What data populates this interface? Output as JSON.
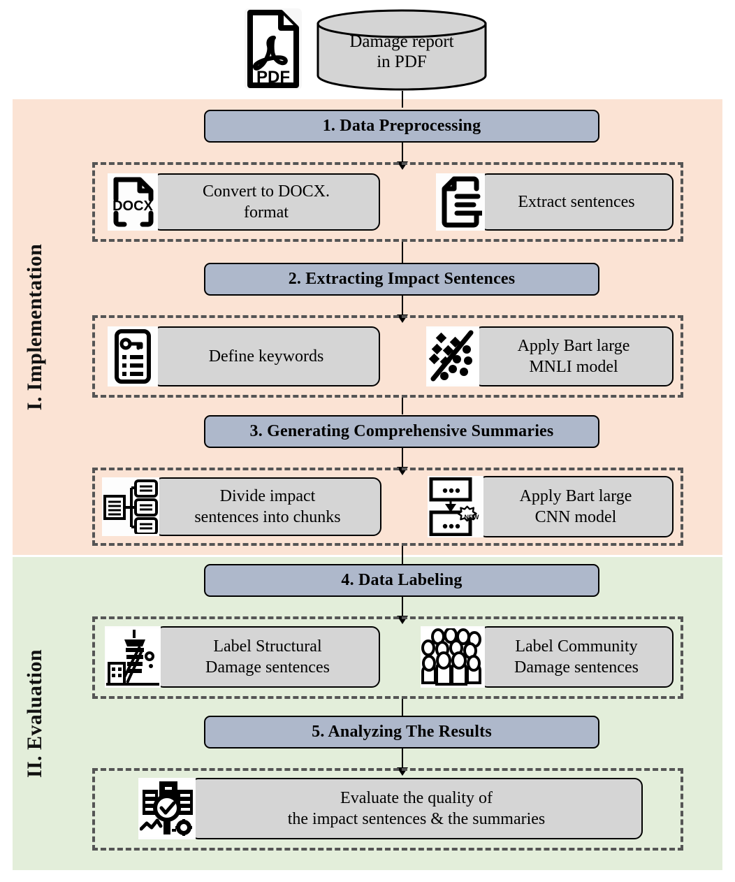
{
  "source": {
    "pdf_icon": "pdf-file-icon",
    "database_label": "Damage report\nin PDF",
    "database_line1": "Damage report",
    "database_line2": "in PDF"
  },
  "sections": [
    {
      "id": "implementation",
      "label": "I. Implementation",
      "color": "#fbe3d4"
    },
    {
      "id": "evaluation",
      "label": "II. Evaluation",
      "color": "#e3eeda"
    }
  ],
  "steps": [
    {
      "id": "step1",
      "title": "1. Data Preprocessing",
      "section": "implementation",
      "tasks": [
        {
          "icon": "docx-file-icon",
          "label_line1": "Convert to DOCX.",
          "label_line2": "format"
        },
        {
          "icon": "extract-sentences-document-icon",
          "label_line1": "Extract sentences",
          "label_line2": ""
        }
      ]
    },
    {
      "id": "step2",
      "title": "2. Extracting Impact Sentences",
      "section": "implementation",
      "tasks": [
        {
          "icon": "keyword-list-icon",
          "label_line1": "Define keywords",
          "label_line2": ""
        },
        {
          "icon": "classification-scatter-icon",
          "label_line1": "Apply Bart large",
          "label_line2": "MNLI model"
        }
      ]
    },
    {
      "id": "step3",
      "title": "3. Generating Comprehensive Summaries",
      "section": "implementation",
      "tasks": [
        {
          "icon": "document-chunking-icon",
          "label_line1": "Divide impact",
          "label_line2": "sentences into chunks"
        },
        {
          "icon": "summarize-new-icon",
          "label_line1": "Apply Bart large",
          "label_line2": "CNN model"
        }
      ]
    },
    {
      "id": "step4",
      "title": "4. Data Labeling",
      "section": "evaluation",
      "tasks": [
        {
          "icon": "damaged-building-icon",
          "label_line1": "Label Structural",
          "label_line2": "Damage sentences"
        },
        {
          "icon": "community-people-icon",
          "label_line1": "Label Community",
          "label_line2": "Damage sentences"
        }
      ]
    },
    {
      "id": "step5",
      "title": "5. Analyzing The Results",
      "section": "evaluation",
      "tasks": [
        {
          "icon": "evaluation-analysis-icon",
          "label_line1": "Evaluate the quality of",
          "label_line2": "the impact sentences & the summaries"
        }
      ]
    }
  ],
  "colors": {
    "implementation_band": "#fbe3d4",
    "evaluation_band": "#e3eeda",
    "process_box": "#aeb8cb",
    "task_pill": "#d5d5d5",
    "dashed_border": "#555555",
    "outline": "#000000"
  },
  "icon_labels": {
    "pdf": "PDF",
    "docx": "DOCX",
    "new_badge": "NEW",
    "dots": "..."
  }
}
